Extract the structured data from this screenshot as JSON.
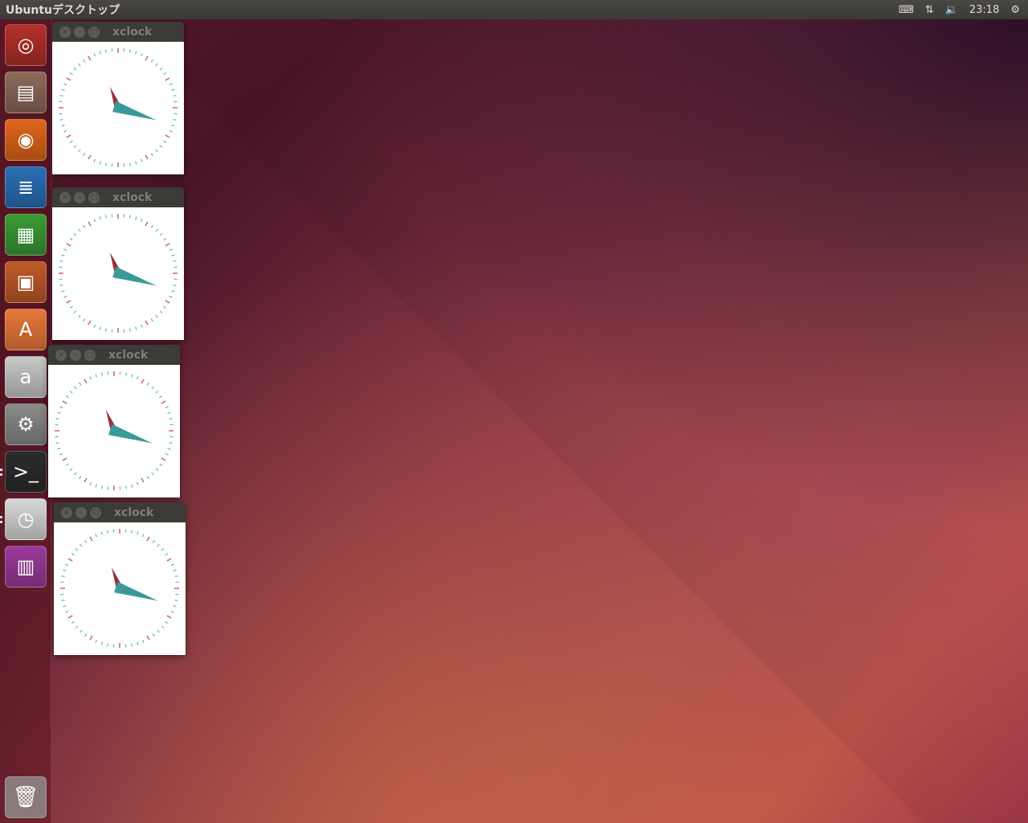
{
  "topbar": {
    "title": "Ubuntuデスクトップ",
    "time": "23:18",
    "icons": [
      "keyboard-icon",
      "network-icon",
      "volume-icon",
      "power-gear-icon"
    ]
  },
  "launcher": {
    "items": [
      {
        "name": "dash-home",
        "glyph": "◎",
        "bg": "#b3302a"
      },
      {
        "name": "files",
        "glyph": "▤",
        "bg": "#8c6a5a"
      },
      {
        "name": "firefox",
        "glyph": "◉",
        "bg": "#e0661b"
      },
      {
        "name": "libreoffice-writer",
        "glyph": "≣",
        "bg": "#2a6fb5"
      },
      {
        "name": "libreoffice-calc",
        "glyph": "▦",
        "bg": "#3b9a35"
      },
      {
        "name": "libreoffice-impress",
        "glyph": "▣",
        "bg": "#c05a28"
      },
      {
        "name": "software-center",
        "glyph": "A",
        "bg": "#e8783a"
      },
      {
        "name": "amazon",
        "glyph": "a",
        "bg": "#c8c8c8"
      },
      {
        "name": "system-settings",
        "glyph": "⚙",
        "bg": "#8a8a8a"
      },
      {
        "name": "terminal",
        "glyph": ">_",
        "bg": "#2c2c2c"
      },
      {
        "name": "xclock",
        "glyph": "◷",
        "bg": "#d8d8d8"
      },
      {
        "name": "remote-desktop",
        "glyph": "▥",
        "bg": "#9a3a9a"
      }
    ],
    "trash": "trash"
  },
  "windows": [
    {
      "title": "xclock"
    },
    {
      "title": "xclock"
    },
    {
      "title": "xclock"
    },
    {
      "title": "xclock"
    }
  ],
  "clock": {
    "hour": 23,
    "minute": 18,
    "hand_colors": {
      "hour": "#9a3040",
      "minute": "#3a9a98"
    }
  }
}
